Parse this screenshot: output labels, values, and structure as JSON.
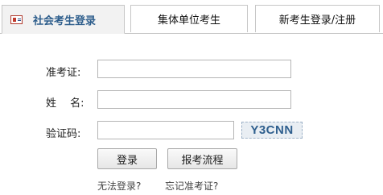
{
  "tabs": [
    {
      "label": "社会考生登录",
      "active": true
    },
    {
      "label": "集体单位考生",
      "active": false
    },
    {
      "label": "新考生登录/注册",
      "active": false
    }
  ],
  "form": {
    "exam_id_label": "准考证:",
    "name_label": "姓　 名:",
    "captcha_label": "验证码:",
    "exam_id_value": "",
    "name_value": "",
    "captcha_value": "",
    "captcha_text": "Y3CNN"
  },
  "buttons": {
    "login": "登录",
    "exam_process": "报考流程"
  },
  "links": {
    "cannot_login": "无法登录?",
    "forgot_exam_id": "忘记准考证?"
  },
  "colors": {
    "active_tab_text": "#2e5e8c",
    "captcha_text": "#2f5f8e"
  }
}
